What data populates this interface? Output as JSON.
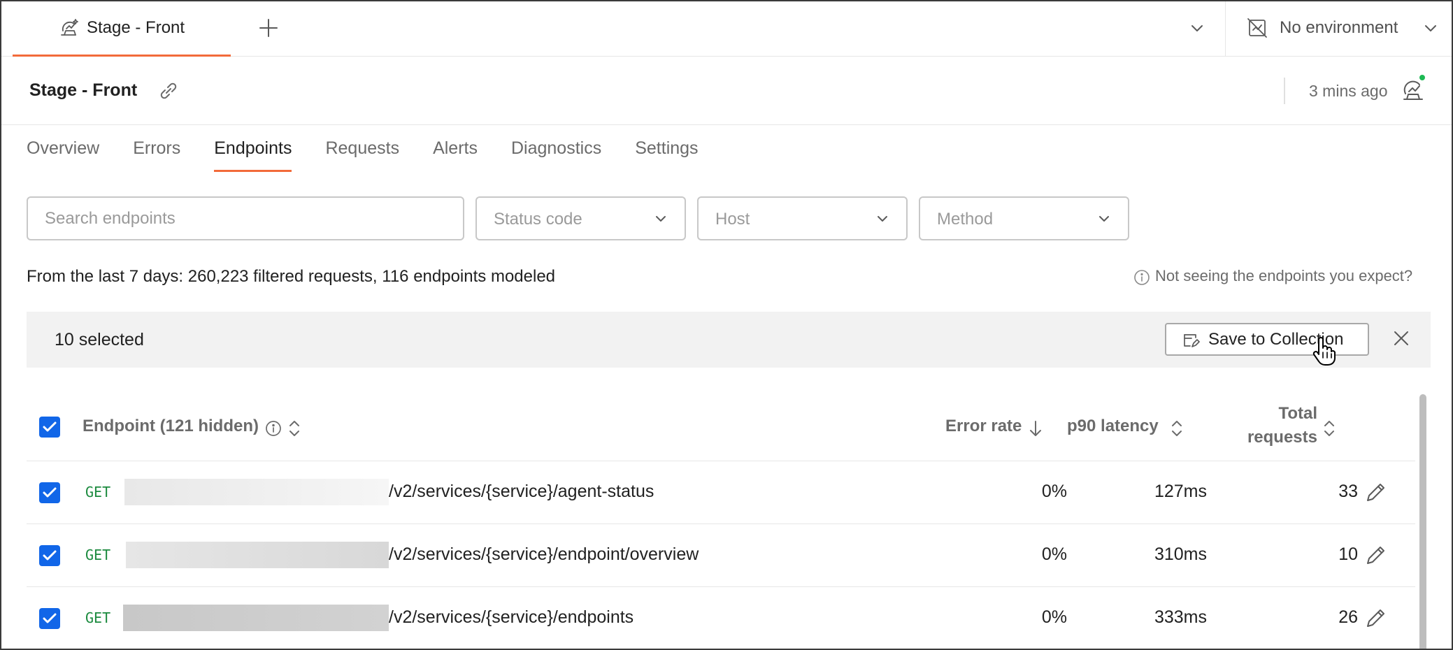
{
  "tabbar": {
    "active_tab": "Stage - Front",
    "environment": "No environment"
  },
  "header": {
    "title": "Stage - Front",
    "updated": "3 mins ago"
  },
  "nav": {
    "tabs": [
      "Overview",
      "Errors",
      "Endpoints",
      "Requests",
      "Alerts",
      "Diagnostics",
      "Settings"
    ],
    "active": "Endpoints"
  },
  "filters": {
    "search_placeholder": "Search endpoints",
    "status_code": "Status code",
    "host": "Host",
    "method": "Method"
  },
  "summary": "From the last 7 days: 260,223 filtered requests, 116 endpoints modeled",
  "help_link": "Not seeing the endpoints you expect?",
  "selection": {
    "count_label": "10 selected",
    "save_label": "Save to Collection"
  },
  "table": {
    "headers": {
      "endpoint": "Endpoint (121 hidden)",
      "error_rate": "Error rate",
      "p90": "p90 latency",
      "total_line1": "Total",
      "total_line2": "requests"
    },
    "rows": [
      {
        "method": "GET",
        "path": "/v2/services/{service}/agent-status",
        "error_rate": "0%",
        "p90": "127ms",
        "total": "33"
      },
      {
        "method": "GET",
        "path": "/v2/services/{service}/endpoint/overview",
        "error_rate": "0%",
        "p90": "310ms",
        "total": "10"
      },
      {
        "method": "GET",
        "path": "/v2/services/{service}/endpoints",
        "error_rate": "0%",
        "p90": "333ms",
        "total": "26"
      }
    ]
  },
  "colors": {
    "accent": "#f26b3a",
    "checkbox": "#1166e8",
    "method_get": "#1b8a3e",
    "online": "#1db954"
  },
  "icons": [
    "monitor-icon",
    "plus-icon",
    "chevron-down-icon",
    "no-environment-icon",
    "link-icon",
    "info-icon",
    "save-collection-icon",
    "close-icon",
    "sort-icon",
    "arrow-down-icon",
    "edit-icon",
    "pointer-cursor-icon"
  ]
}
